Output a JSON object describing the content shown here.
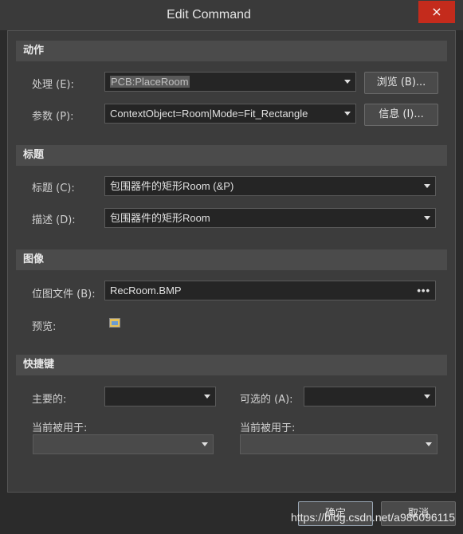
{
  "window": {
    "title": "Edit Command",
    "close_icon": "×"
  },
  "action": {
    "header": "动作",
    "process_label": "处理 (E):",
    "process_value": "PCB:PlaceRoom",
    "params_label": "参数 (P):",
    "params_value": "ContextObject=Room|Mode=Fit_Rectangle",
    "browse_button": "浏览 (B)...",
    "info_button": "信息 (I)..."
  },
  "caption": {
    "header": "标题",
    "title_label": "标题 (C):",
    "title_value": "包围器件的矩形Room (&P)",
    "desc_label": "描述 (D):",
    "desc_value": "包围器件的矩形Room"
  },
  "image": {
    "header": "图像",
    "bitmap_label": "位图文件 (B):",
    "bitmap_value": "RecRoom.BMP",
    "browse_dots": "•••",
    "preview_label": "预览:"
  },
  "shortcut": {
    "header": "快捷键",
    "primary_label": "主要的:",
    "primary_value": "",
    "alternate_label": "可选的 (A):",
    "alternate_value": "",
    "current_used_label_1": "当前被用于:",
    "current_used_label_2": "当前被用于:"
  },
  "footer": {
    "ok_button": "确定",
    "cancel_button": "取消",
    "watermark": "https://blog.csdn.net/a986096115"
  }
}
